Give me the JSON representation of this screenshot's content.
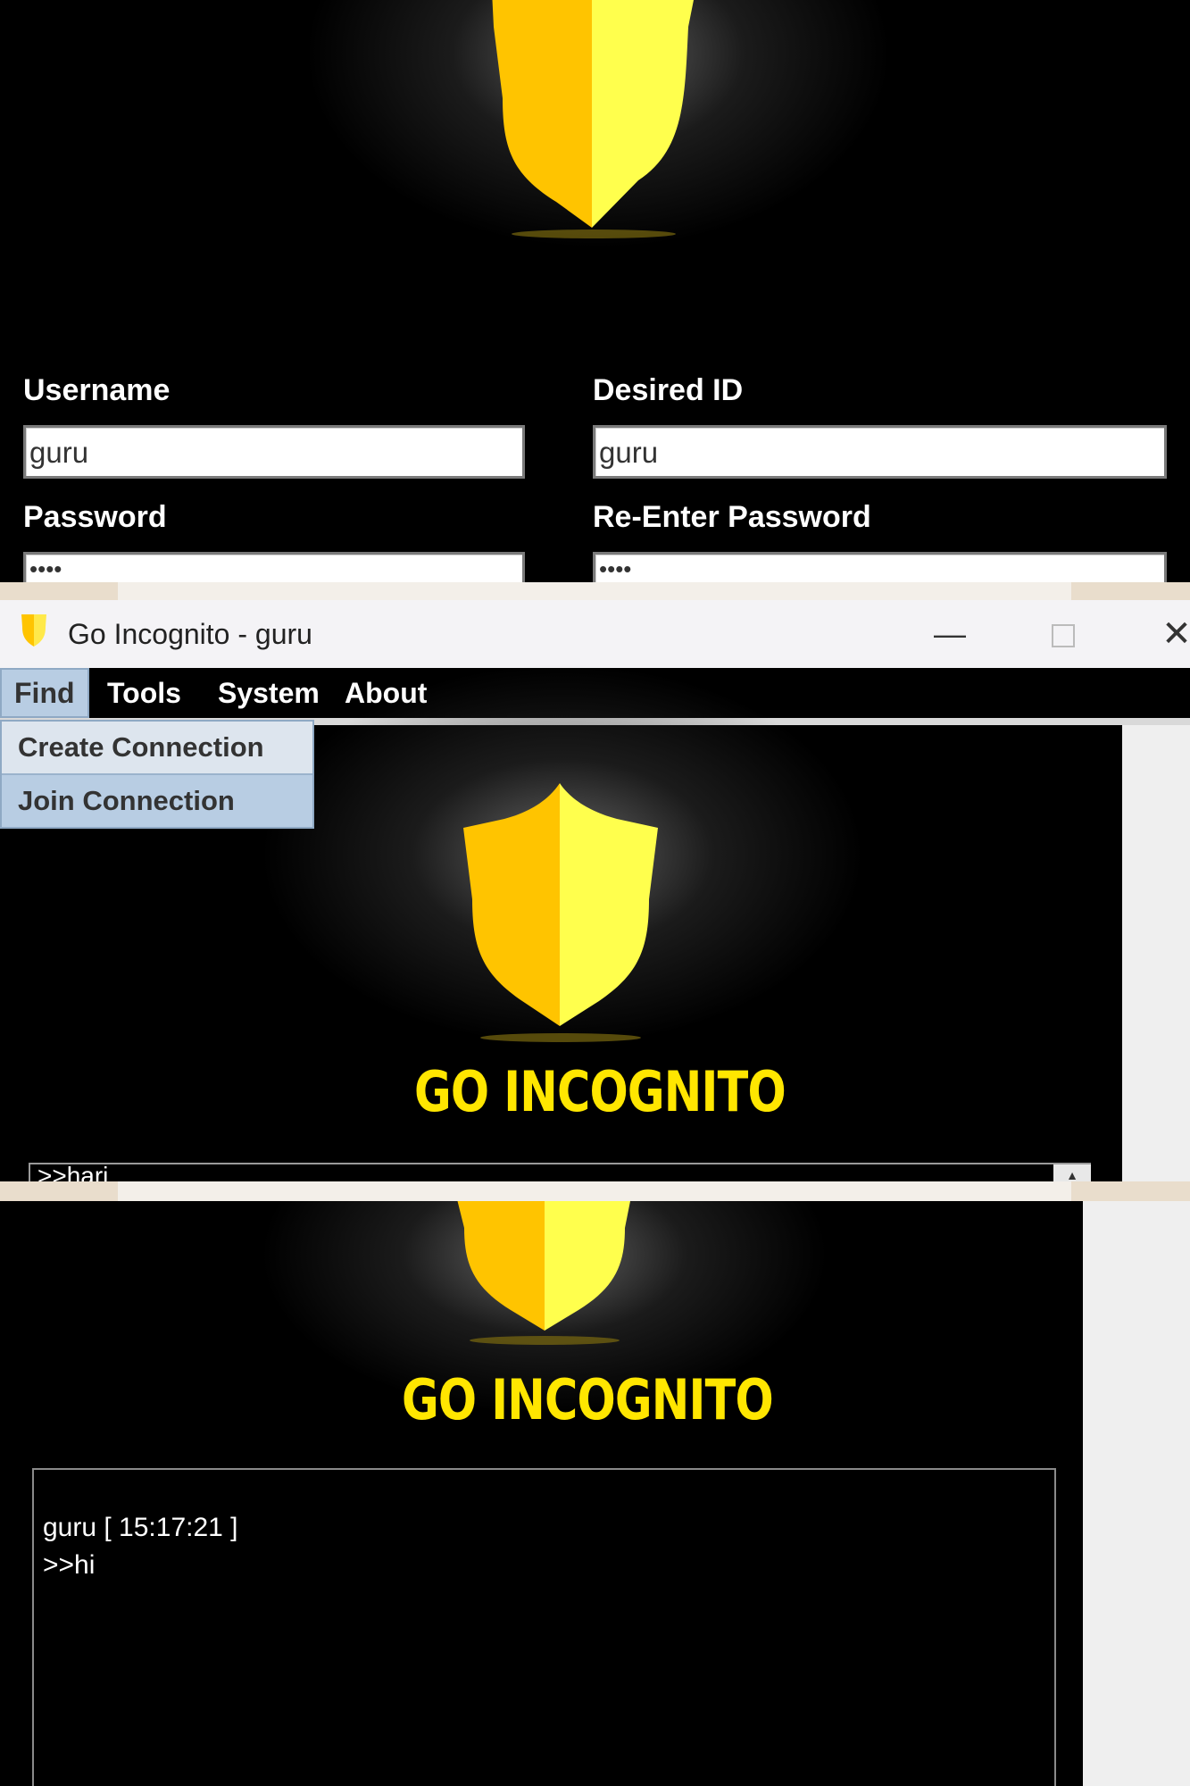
{
  "colors": {
    "brand_yellow": "#ffe600",
    "shield_left": "#ffc400",
    "shield_right": "#ffff4d",
    "menu_highlight": "#b8cde3"
  },
  "register": {
    "username_label": "Username",
    "username_value": "guru",
    "desired_id_label": "Desired ID",
    "desired_id_value": "guru",
    "password_label": "Password",
    "password_value": "••••",
    "reenter_password_label": "Re-Enter Password",
    "reenter_password_value": "••••"
  },
  "window": {
    "title": "Go Incognito - guru",
    "minimize_icon": "minimize-icon",
    "maximize_icon": "maximize-icon",
    "close_icon": "close-icon"
  },
  "menu": {
    "items": [
      {
        "label": "Find"
      },
      {
        "label": "Tools"
      },
      {
        "label": "System"
      },
      {
        "label": "About"
      }
    ],
    "find_dropdown": [
      {
        "label": "Create Connection"
      },
      {
        "label": "Join Connection"
      }
    ]
  },
  "brand": {
    "name": "GO INCOGNITO"
  },
  "chat_preview": {
    "text": ">>hari"
  },
  "chat": {
    "sender_line": "guru [ 15:17:21 ]",
    "message": ">>hi"
  }
}
